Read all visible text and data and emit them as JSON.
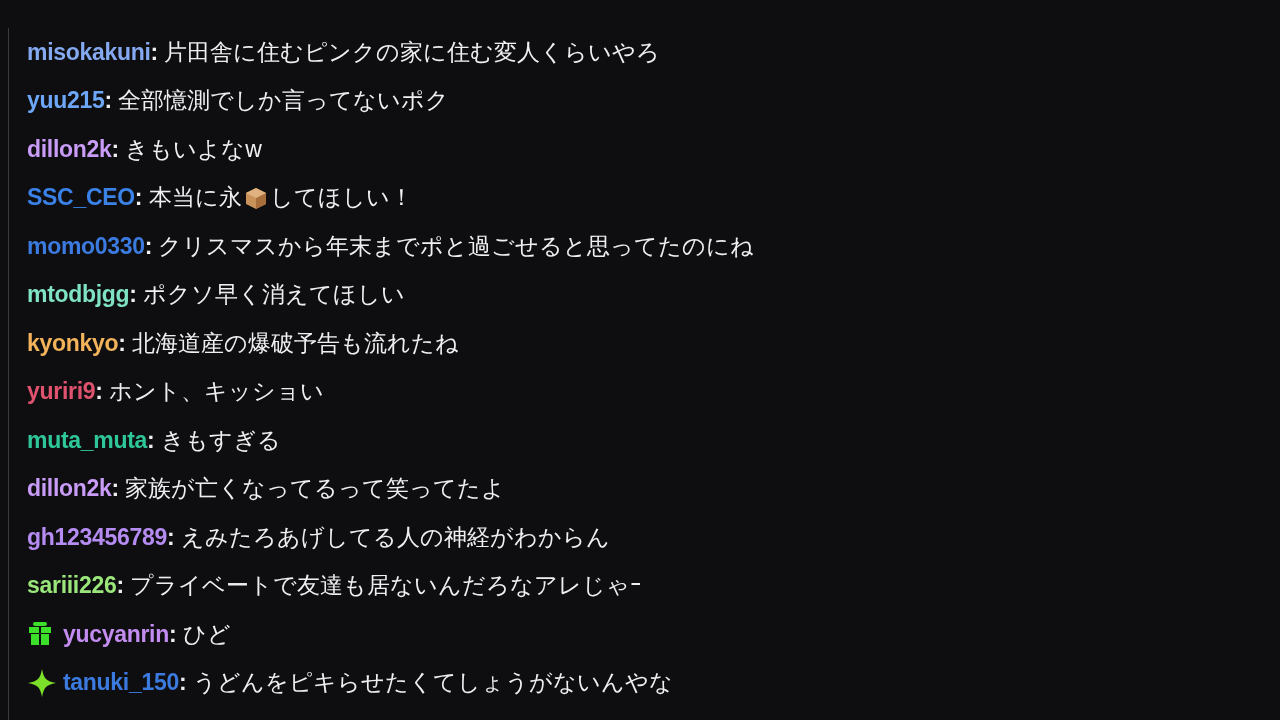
{
  "chat_messages": [
    {
      "user": "misokakuni",
      "color": "#84a9f0",
      "colon": ":",
      "parts": [
        {
          "kind": "text",
          "text": "片田舎に住むピンクの家に住む変人くらいやろ"
        }
      ]
    },
    {
      "user": "yuu215",
      "color": "#6ea6f7",
      "colon": ":",
      "parts": [
        {
          "kind": "text",
          "text": "全部憶測でしか言ってないポク"
        }
      ]
    },
    {
      "user": "dillon2k",
      "color": "#c89cf7",
      "colon": ":",
      "parts": [
        {
          "kind": "text",
          "text": "きもいよなw"
        }
      ]
    },
    {
      "user": "SSC_CEO",
      "color": "#3b82e8",
      "colon": ":",
      "parts": [
        {
          "kind": "text",
          "text": "本当に永"
        },
        {
          "kind": "package"
        },
        {
          "kind": "text",
          "text": "してほしい！"
        }
      ]
    },
    {
      "user": "momo0330",
      "color": "#3b7be0",
      "colon": ":",
      "parts": [
        {
          "kind": "text",
          "text": "クリスマスから年末までポと過ごせると思ってたのにね"
        }
      ]
    },
    {
      "user": "mtodbjgg",
      "color": "#7fe3c4",
      "colon": ":",
      "parts": [
        {
          "kind": "text",
          "text": "ポクソ早く消えてほしい"
        }
      ]
    },
    {
      "user": "kyonkyo",
      "color": "#f2b35a",
      "colon": ":",
      "parts": [
        {
          "kind": "text",
          "text": "北海道産の爆破予告も流れたね"
        }
      ]
    },
    {
      "user": "yuriri9",
      "color": "#e0536e",
      "colon": ":",
      "parts": [
        {
          "kind": "text",
          "text": "ホント、キッショい"
        }
      ]
    },
    {
      "user": "muta_muta",
      "color": "#2ec79a",
      "colon": ":",
      "parts": [
        {
          "kind": "text",
          "text": "きもすぎる"
        }
      ]
    },
    {
      "user": "dillon2k",
      "color": "#c89cf7",
      "colon": ":",
      "parts": [
        {
          "kind": "text",
          "text": "家族が亡くなってるって笑ってたよ"
        }
      ]
    },
    {
      "user": "gh123456789",
      "color": "#b58cf2",
      "colon": ":",
      "parts": [
        {
          "kind": "text",
          "text": "えみたろあげしてる人の神経がわからん"
        }
      ]
    },
    {
      "user": "sariii226",
      "color": "#9be67a",
      "colon": ":",
      "parts": [
        {
          "kind": "text",
          "text": "プライベートで友達も居ないんだろなアレじゃｰ"
        }
      ]
    },
    {
      "user": "yucyanrin",
      "color": "#c38cf0",
      "colon": ":",
      "badge": {
        "kind": "gift"
      },
      "parts": [
        {
          "kind": "text",
          "text": "ひど"
        }
      ]
    },
    {
      "user": "tanuki_150",
      "color": "#3b7be0",
      "colon": ":",
      "badge": {
        "kind": "sparkle"
      },
      "parts": [
        {
          "kind": "text",
          "text": "うどんをピキらせたくてしょうがないんやな"
        }
      ]
    }
  ]
}
